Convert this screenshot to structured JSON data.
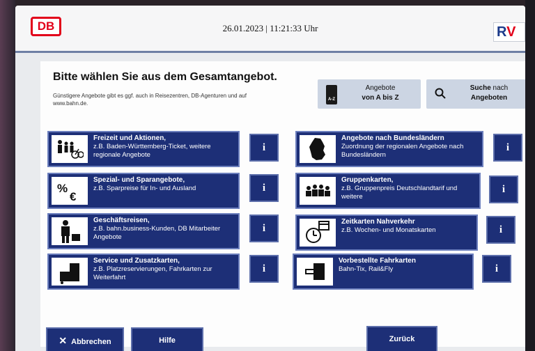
{
  "header": {
    "datetime": "26.01.2023 | 11:21:33 Uhr",
    "db_logo": "DB",
    "rv_logo_r": "R",
    "rv_logo_v": "V"
  },
  "main": {
    "title": "Bitte wählen Sie aus dem Gesamtangebot.",
    "subtitle": "Günstigere Angebote gibt es ggf. auch in Reisezentren, DB-Agenturen und auf www.bahn.de.",
    "az_button": {
      "icon_text": "A-Z",
      "line1": "Angebote",
      "line2": "von A bis Z",
      "icon": "phone-az-icon"
    },
    "search_button": {
      "line1_bold": "Suche",
      "line1_rest": " nach",
      "line2": "Angeboten",
      "icon": "search-icon"
    }
  },
  "tiles": [
    {
      "title": "Freizeit und Aktionen,",
      "desc": "z.B. Baden-Württemberg-Ticket, weitere regionale Angebote",
      "icon": "family-bike-icon"
    },
    {
      "title": "Spezial- und Sparangebote,",
      "desc": "z.B. Sparpreise für In- und Ausland",
      "icon": "percent-euro-icon"
    },
    {
      "title": "Geschäftsreisen,",
      "desc": "z.B. bahn.business-Kunden, DB Mitarbeiter Angebote",
      "icon": "business-person-icon"
    },
    {
      "title": "Service und Zusatzkarten,",
      "desc": "z.B. Platzreservierungen, Fahrkarten zur Weiterfahrt",
      "icon": "luggage-icon"
    },
    {
      "title": "Angebote nach Bundesländern",
      "desc": "Zuordnung der regionalen Angebote nach Bundesländern",
      "icon": "germany-map-icon"
    },
    {
      "title": "Gruppenkarten,",
      "desc": "z.B. Gruppenpreis Deutschlandtarif und weitere",
      "icon": "group-icon"
    },
    {
      "title": "Zeitkarten Nahverkehr",
      "desc": "z.B. Wochen- und Monatskarten",
      "icon": "clock-calendar-icon"
    },
    {
      "title": "Vorbestellte Fahrkarten",
      "desc": "Bahn-Tix, Rail&Fly",
      "icon": "ticket-printer-icon"
    }
  ],
  "info_label": "i",
  "footer": {
    "cancel_icon": "✕",
    "cancel": "Abbrechen",
    "help": "Hilfe",
    "back": "Zurück"
  },
  "colors": {
    "tile_blue": "#1d2f77",
    "db_red": "#e2001a",
    "button_grey_blue": "#ccd5e3"
  }
}
